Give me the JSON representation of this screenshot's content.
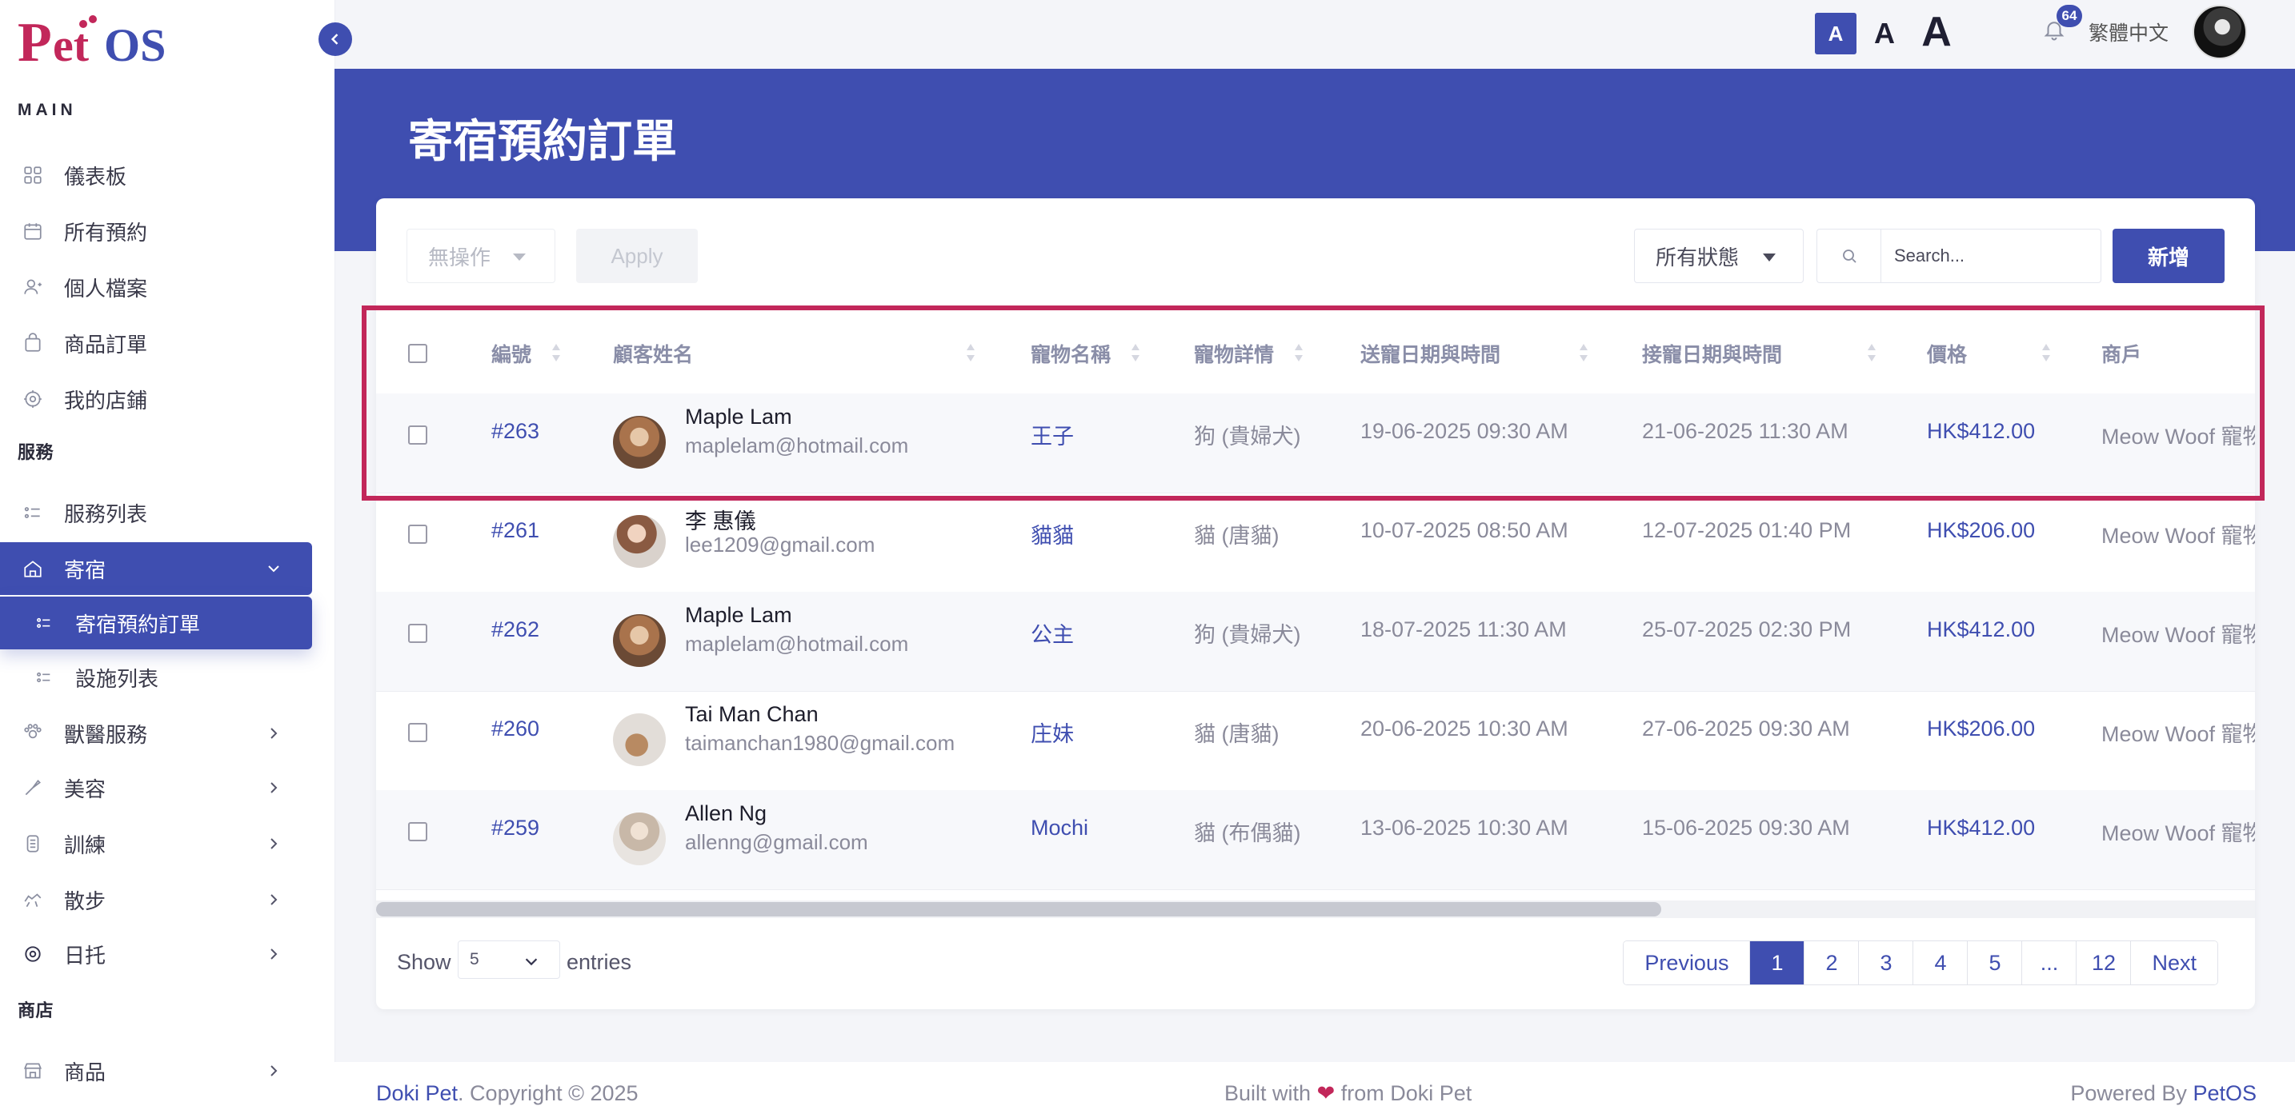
{
  "brand": {
    "logo_text": "PetOS",
    "color": "#3f4eb0",
    "accent": "#c2275a"
  },
  "topbar": {
    "font_small": "A",
    "font_mid": "A",
    "font_large": "A",
    "notification_count": "64",
    "language": "繁體中文"
  },
  "sidebar": {
    "sections": {
      "main": "MAIN",
      "services": "服務",
      "shop": "商店"
    },
    "main_items": [
      {
        "label": "儀表板",
        "icon": "dashboard-icon"
      },
      {
        "label": "所有預約",
        "icon": "calendar-icon"
      },
      {
        "label": "個人檔案",
        "icon": "user-icon"
      },
      {
        "label": "商品訂單",
        "icon": "bag-icon"
      },
      {
        "label": "我的店鋪",
        "icon": "store-icon"
      }
    ],
    "service_items": [
      {
        "label": "服務列表",
        "icon": "list-icon"
      },
      {
        "label": "寄宿",
        "icon": "home-icon"
      },
      {
        "label": "寄宿預約訂單",
        "icon": "list-icon"
      },
      {
        "label": "設施列表",
        "icon": "list-icon"
      },
      {
        "label": "獸醫服務",
        "icon": "vet-icon"
      },
      {
        "label": "美容",
        "icon": "grooming-icon"
      },
      {
        "label": "訓練",
        "icon": "training-icon"
      },
      {
        "label": "散步",
        "icon": "walking-icon"
      },
      {
        "label": "日托",
        "icon": "daycare-icon"
      }
    ],
    "shop_items": [
      {
        "label": "商品",
        "icon": "shop-icon"
      }
    ]
  },
  "page": {
    "title": "寄宿預約訂單"
  },
  "toolbar": {
    "bulk_action": "無操作",
    "apply_label": "Apply",
    "status_filter": "所有狀態",
    "search_placeholder": "Search...",
    "add_label": "新增"
  },
  "table": {
    "columns": [
      "編號",
      "顧客姓名",
      "寵物名稱",
      "寵物詳情",
      "送寵日期與時間",
      "接寵日期與時間",
      "價格",
      "商戶"
    ],
    "rows": [
      {
        "id": "#263",
        "name": "Maple Lam",
        "email": "maplelam@hotmail.com",
        "pet": "王子",
        "detail": "狗 (貴婦犬)",
        "dropoff": "19-06-2025 09:30 AM",
        "pickup": "21-06-2025 11:30 AM",
        "price": "HK$412.00",
        "merchant": "Meow Woof 寵物"
      },
      {
        "id": "#261",
        "name": "李 惠儀",
        "email": "lee1209@gmail.com",
        "pet": "貓貓",
        "detail": "貓 (唐貓)",
        "dropoff": "10-07-2025 08:50 AM",
        "pickup": "12-07-2025 01:40 PM",
        "price": "HK$206.00",
        "merchant": "Meow Woof 寵物"
      },
      {
        "id": "#262",
        "name": "Maple Lam",
        "email": "maplelam@hotmail.com",
        "pet": "公主",
        "detail": "狗 (貴婦犬)",
        "dropoff": "18-07-2025 11:30 AM",
        "pickup": "25-07-2025 02:30 PM",
        "price": "HK$412.00",
        "merchant": "Meow Woof 寵物"
      },
      {
        "id": "#260",
        "name": "Tai Man Chan",
        "email": "taimanchan1980@gmail.com",
        "pet": "庄妹",
        "detail": "貓 (唐貓)",
        "dropoff": "20-06-2025 10:30 AM",
        "pickup": "27-06-2025 09:30 AM",
        "price": "HK$206.00",
        "merchant": "Meow Woof 寵物"
      },
      {
        "id": "#259",
        "name": "Allen Ng",
        "email": "allenng@gmail.com",
        "pet": "Mochi",
        "detail": "貓 (布偶貓)",
        "dropoff": "13-06-2025 10:30 AM",
        "pickup": "15-06-2025 09:30 AM",
        "price": "HK$412.00",
        "merchant": "Meow Woof 寵物"
      }
    ]
  },
  "pagination": {
    "show_label": "Show",
    "page_size": "5",
    "entries_label": "entries",
    "previous": "Previous",
    "pages": [
      "1",
      "2",
      "3",
      "4",
      "5",
      "...",
      "12"
    ],
    "next": "Next",
    "current": "1"
  },
  "footer": {
    "left_brand": "Doki Pet",
    "left_text": ". Copyright © 2025",
    "mid_prefix": "Built with",
    "mid_suffix": "from Doki Pet",
    "right_prefix": "Powered By",
    "right_brand": "PetOS"
  }
}
